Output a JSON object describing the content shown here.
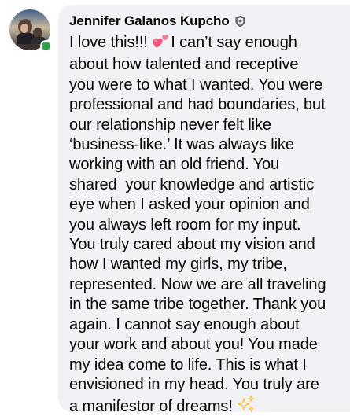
{
  "author": {
    "name": "Jennifer Galanos Kupcho",
    "badge_icon": "shield-icon",
    "online": true
  },
  "comment": {
    "lines": [
      {
        "before": "I love this!!! ",
        "emoji": "two-hearts-emoji",
        "after": "I can’t say enough"
      },
      {
        "text": "about how talented and receptive"
      },
      {
        "text": "you were to what I wanted. You were"
      },
      {
        "text": "professional and had boundaries, but"
      },
      {
        "text": "our relationship never felt like"
      },
      {
        "text": "‘business-like.’ It was always like"
      },
      {
        "text": "working with an old friend. You"
      },
      {
        "text": "shared  your knowledge and artistic"
      },
      {
        "text": "eye when I asked your opinion and"
      },
      {
        "text": "you always left room for my input."
      },
      {
        "text": "You truly cared about my vision and"
      },
      {
        "text": "how I wanted my girls, my tribe,"
      },
      {
        "text": "represented. Now we are all traveling"
      },
      {
        "text": "in the same tribe together. Thank you"
      },
      {
        "text": "again. I cannot say enough about"
      },
      {
        "text": "your work and about you! You made"
      },
      {
        "text": "my idea come to life. This is what I"
      },
      {
        "text": "envisioned in my head. You truly are"
      },
      {
        "before": "a manifestor of dreams! ",
        "emoji": "sparkles-emoji",
        "after": ""
      }
    ]
  },
  "colors": {
    "bubble_background": "#f0f2f5",
    "text": "#050505",
    "online_indicator": "#31a24c",
    "heart": "#f4557a",
    "sparkle": "#f7c948"
  }
}
